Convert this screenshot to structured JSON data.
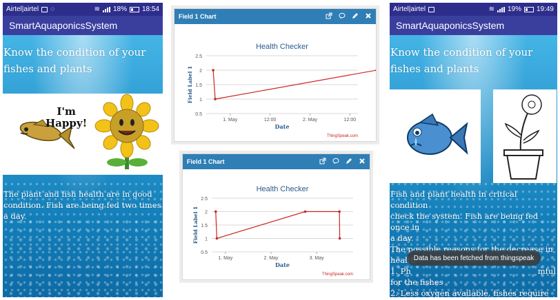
{
  "left_phone": {
    "status": {
      "carrier": "Airtel|airtel",
      "battery": "18%",
      "time": "18:54"
    },
    "app_title": "SmartAquaponicsSystem",
    "headline": "Know the condition of your fishes and plants",
    "speech": {
      "line1": "I'm",
      "line2": "Happy!"
    },
    "message": "The plant and fish health are in good condition. Fish are being fed two times a day."
  },
  "right_phone": {
    "status": {
      "carrier": "Airtel|airtel",
      "battery": "19%",
      "time": "19:49"
    },
    "app_title": "SmartAquaponicsSystem",
    "headline": "Know the condition of your fishes and plants",
    "message_lines": [
      "Fish and plant health in critical condition",
      "check the system. Fish are being fed once in",
      "a day.",
      "The possible reasons for the decrease in",
      "health",
      "1. Ph",
      "for the fishes",
      "2. Less oxygen available, fishes require"
    ],
    "message_tail": "mful",
    "toast": "Data has been fetched from thingspeak"
  },
  "cards": [
    {
      "header": "Field 1 Chart",
      "credit": "ThingSpeak.com"
    },
    {
      "header": "Field 1 Chart",
      "credit": "ThingSpeak.com"
    }
  ],
  "chart_data": [
    {
      "type": "line",
      "title": "Health Checker",
      "xlabel": "Date",
      "ylabel": "Field Label 1",
      "ylim": [
        0.5,
        2.5
      ],
      "yticks": [
        "2.5",
        "2",
        "1.5",
        "1",
        "0.5"
      ],
      "xticks": [
        "1. May",
        "12:00",
        "2. May",
        "12:00"
      ],
      "color": "#cc2222",
      "x": [
        "30. Apr 18:54",
        "30. Apr 19:30",
        "2. May 20:00"
      ],
      "y": [
        2,
        1,
        2
      ]
    },
    {
      "type": "line",
      "title": "Health Checker",
      "xlabel": "Date",
      "ylabel": "Field Label 1",
      "ylim": [
        0.5,
        2.5
      ],
      "yticks": [
        "2.5",
        "2",
        "1.5",
        "1",
        "0.5"
      ],
      "xticks": [
        "1. May",
        "2. May",
        "3. May"
      ],
      "color": "#cc2222",
      "x": [
        "30. Apr 18:54",
        "30. Apr 19:30",
        "2. May 18:00",
        "3. May 12:00",
        "3. May 12:10"
      ],
      "y": [
        2,
        1,
        2,
        2,
        1
      ]
    }
  ]
}
